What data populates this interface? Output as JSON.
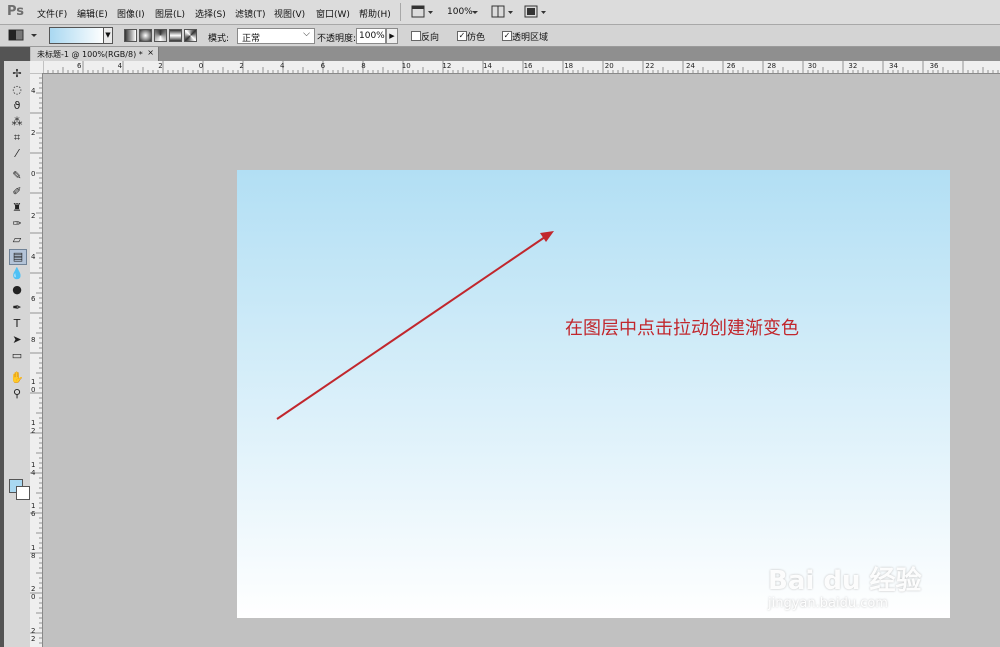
{
  "app": {
    "logo": "Ps"
  },
  "menu": [
    {
      "label": "文件(F)"
    },
    {
      "label": "编辑(E)"
    },
    {
      "label": "图像(I)"
    },
    {
      "label": "图层(L)"
    },
    {
      "label": "选择(S)"
    },
    {
      "label": "滤镜(T)"
    },
    {
      "label": "视图(V)"
    },
    {
      "label": "窗口(W)"
    },
    {
      "label": "帮助(H)"
    }
  ],
  "menubar_controls": {
    "zoom": "100%"
  },
  "options": {
    "mode_label": "模式:",
    "mode_value": "正常",
    "opacity_label": "不透明度:",
    "opacity_value": "100%",
    "reverse_label": "反向",
    "dither_label": "仿色",
    "transparency_label": "透明区域",
    "reverse_checked": false,
    "dither_checked": true,
    "transparency_checked": true
  },
  "document": {
    "tab_title": "未标题-1 @ 100%(RGB/8) *",
    "close": "×",
    "gradient_from": "#b2dff4",
    "gradient_to": "#ffffff"
  },
  "ruler_top": [
    "6",
    "4",
    "2",
    "0",
    "2",
    "4",
    "6",
    "8",
    "10",
    "12",
    "14",
    "16",
    "18",
    "20",
    "22",
    "24",
    "26",
    "28",
    "30",
    "32",
    "34",
    "36"
  ],
  "ruler_left": [
    "4",
    "2",
    "0",
    "2",
    "4",
    "6",
    "8",
    "1 0",
    "1 2",
    "1 4",
    "1 6",
    "1 8",
    "2 0",
    "2 2"
  ],
  "annotation": "在图层中点击拉动创建渐变色",
  "annotation_color": "#c1272d",
  "watermark": {
    "brand": "Bai du 经验",
    "url": "jingyan.baidu.com"
  },
  "tools": [
    {
      "icon": "move-icon",
      "glyph": "✢"
    },
    {
      "icon": "marquee-icon",
      "glyph": "◌"
    },
    {
      "icon": "lasso-icon",
      "glyph": "ϑ"
    },
    {
      "icon": "quick-select-icon",
      "glyph": "⁂"
    },
    {
      "icon": "crop-icon",
      "glyph": "⌗"
    },
    {
      "icon": "eyedropper-icon",
      "glyph": "⁄"
    },
    {
      "icon": "healing-icon",
      "glyph": "✎"
    },
    {
      "icon": "brush-icon",
      "glyph": "✐"
    },
    {
      "icon": "stamp-icon",
      "glyph": "♜"
    },
    {
      "icon": "history-brush-icon",
      "glyph": "✑"
    },
    {
      "icon": "eraser-icon",
      "glyph": "▱"
    },
    {
      "icon": "gradient-icon",
      "glyph": "▤"
    },
    {
      "icon": "blur-icon",
      "glyph": "💧"
    },
    {
      "icon": "dodge-icon",
      "glyph": "●"
    },
    {
      "icon": "pen-icon",
      "glyph": "✒"
    },
    {
      "icon": "type-icon",
      "glyph": "T"
    },
    {
      "icon": "path-select-icon",
      "glyph": "➤"
    },
    {
      "icon": "shape-icon",
      "glyph": "▭"
    },
    {
      "icon": "hand-icon",
      "glyph": "✋"
    },
    {
      "icon": "zoom-icon",
      "glyph": "⚲"
    }
  ]
}
